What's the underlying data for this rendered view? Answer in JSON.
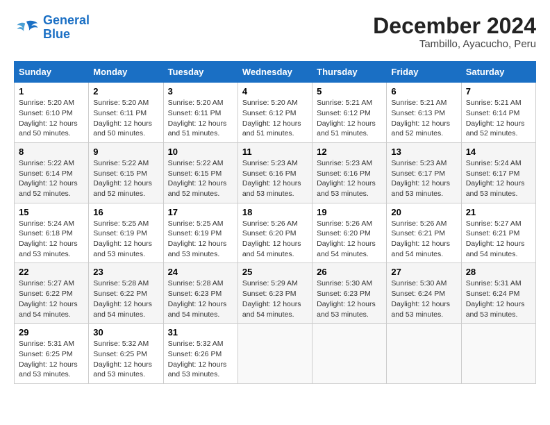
{
  "header": {
    "logo_line1": "General",
    "logo_line2": "Blue",
    "title": "December 2024",
    "subtitle": "Tambillo, Ayacucho, Peru"
  },
  "columns": [
    "Sunday",
    "Monday",
    "Tuesday",
    "Wednesday",
    "Thursday",
    "Friday",
    "Saturday"
  ],
  "weeks": [
    [
      {
        "day": "1",
        "sunrise": "5:20 AM",
        "sunset": "6:10 PM",
        "daylight": "12 hours and 50 minutes."
      },
      {
        "day": "2",
        "sunrise": "5:20 AM",
        "sunset": "6:11 PM",
        "daylight": "12 hours and 50 minutes."
      },
      {
        "day": "3",
        "sunrise": "5:20 AM",
        "sunset": "6:11 PM",
        "daylight": "12 hours and 51 minutes."
      },
      {
        "day": "4",
        "sunrise": "5:20 AM",
        "sunset": "6:12 PM",
        "daylight": "12 hours and 51 minutes."
      },
      {
        "day": "5",
        "sunrise": "5:21 AM",
        "sunset": "6:12 PM",
        "daylight": "12 hours and 51 minutes."
      },
      {
        "day": "6",
        "sunrise": "5:21 AM",
        "sunset": "6:13 PM",
        "daylight": "12 hours and 52 minutes."
      },
      {
        "day": "7",
        "sunrise": "5:21 AM",
        "sunset": "6:14 PM",
        "daylight": "12 hours and 52 minutes."
      }
    ],
    [
      {
        "day": "8",
        "sunrise": "5:22 AM",
        "sunset": "6:14 PM",
        "daylight": "12 hours and 52 minutes."
      },
      {
        "day": "9",
        "sunrise": "5:22 AM",
        "sunset": "6:15 PM",
        "daylight": "12 hours and 52 minutes."
      },
      {
        "day": "10",
        "sunrise": "5:22 AM",
        "sunset": "6:15 PM",
        "daylight": "12 hours and 52 minutes."
      },
      {
        "day": "11",
        "sunrise": "5:23 AM",
        "sunset": "6:16 PM",
        "daylight": "12 hours and 53 minutes."
      },
      {
        "day": "12",
        "sunrise": "5:23 AM",
        "sunset": "6:16 PM",
        "daylight": "12 hours and 53 minutes."
      },
      {
        "day": "13",
        "sunrise": "5:23 AM",
        "sunset": "6:17 PM",
        "daylight": "12 hours and 53 minutes."
      },
      {
        "day": "14",
        "sunrise": "5:24 AM",
        "sunset": "6:17 PM",
        "daylight": "12 hours and 53 minutes."
      }
    ],
    [
      {
        "day": "15",
        "sunrise": "5:24 AM",
        "sunset": "6:18 PM",
        "daylight": "12 hours and 53 minutes."
      },
      {
        "day": "16",
        "sunrise": "5:25 AM",
        "sunset": "6:19 PM",
        "daylight": "12 hours and 53 minutes."
      },
      {
        "day": "17",
        "sunrise": "5:25 AM",
        "sunset": "6:19 PM",
        "daylight": "12 hours and 53 minutes."
      },
      {
        "day": "18",
        "sunrise": "5:26 AM",
        "sunset": "6:20 PM",
        "daylight": "12 hours and 54 minutes."
      },
      {
        "day": "19",
        "sunrise": "5:26 AM",
        "sunset": "6:20 PM",
        "daylight": "12 hours and 54 minutes."
      },
      {
        "day": "20",
        "sunrise": "5:26 AM",
        "sunset": "6:21 PM",
        "daylight": "12 hours and 54 minutes."
      },
      {
        "day": "21",
        "sunrise": "5:27 AM",
        "sunset": "6:21 PM",
        "daylight": "12 hours and 54 minutes."
      }
    ],
    [
      {
        "day": "22",
        "sunrise": "5:27 AM",
        "sunset": "6:22 PM",
        "daylight": "12 hours and 54 minutes."
      },
      {
        "day": "23",
        "sunrise": "5:28 AM",
        "sunset": "6:22 PM",
        "daylight": "12 hours and 54 minutes."
      },
      {
        "day": "24",
        "sunrise": "5:28 AM",
        "sunset": "6:23 PM",
        "daylight": "12 hours and 54 minutes."
      },
      {
        "day": "25",
        "sunrise": "5:29 AM",
        "sunset": "6:23 PM",
        "daylight": "12 hours and 54 minutes."
      },
      {
        "day": "26",
        "sunrise": "5:30 AM",
        "sunset": "6:23 PM",
        "daylight": "12 hours and 53 minutes."
      },
      {
        "day": "27",
        "sunrise": "5:30 AM",
        "sunset": "6:24 PM",
        "daylight": "12 hours and 53 minutes."
      },
      {
        "day": "28",
        "sunrise": "5:31 AM",
        "sunset": "6:24 PM",
        "daylight": "12 hours and 53 minutes."
      }
    ],
    [
      {
        "day": "29",
        "sunrise": "5:31 AM",
        "sunset": "6:25 PM",
        "daylight": "12 hours and 53 minutes."
      },
      {
        "day": "30",
        "sunrise": "5:32 AM",
        "sunset": "6:25 PM",
        "daylight": "12 hours and 53 minutes."
      },
      {
        "day": "31",
        "sunrise": "5:32 AM",
        "sunset": "6:26 PM",
        "daylight": "12 hours and 53 minutes."
      },
      null,
      null,
      null,
      null
    ]
  ],
  "labels": {
    "sunrise": "Sunrise:",
    "sunset": "Sunset:",
    "daylight": "Daylight:"
  }
}
